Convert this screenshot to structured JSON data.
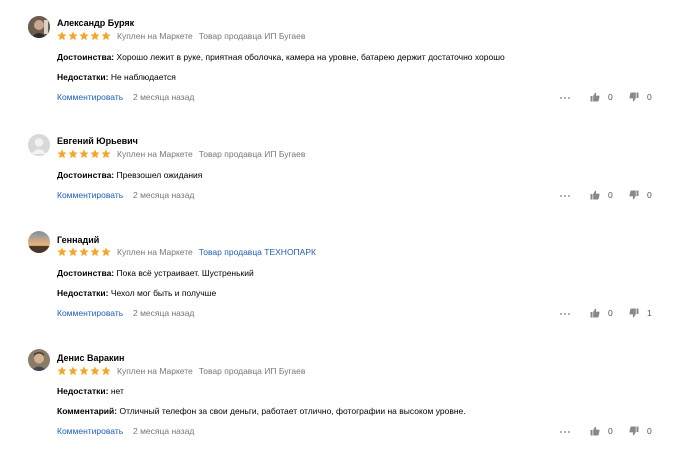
{
  "reviews": [
    {
      "author": "Александр Буряк",
      "rating": 5,
      "bought_label": "Куплен на Маркете",
      "seller_label": "Товар продавца ИП Бугаев",
      "seller_is_link": false,
      "fields": [
        {
          "label": "Достоинства:",
          "text": "Хорошо лежит в руке, приятная оболочка, камера на уровне, батарею держит достаточно хорошо"
        },
        {
          "label": "Недостатки:",
          "text": "Не наблюдается"
        }
      ],
      "comment_label": "Комментировать",
      "date": "2 месяца назад",
      "likes": "0",
      "dislikes": "0"
    },
    {
      "author": "Евгений Юрьевич",
      "rating": 5,
      "bought_label": "Куплен на Маркете",
      "seller_label": "Товар продавца ИП Бугаев",
      "seller_is_link": false,
      "fields": [
        {
          "label": "Достоинства:",
          "text": "Превзошел ожидания"
        }
      ],
      "comment_label": "Комментировать",
      "date": "2 месяца назад",
      "likes": "0",
      "dislikes": "0"
    },
    {
      "author": "Геннадий",
      "rating": 5,
      "bought_label": "Куплен на Маркете",
      "seller_label": "Товар продавца ТЕХНОПАРК",
      "seller_is_link": true,
      "fields": [
        {
          "label": "Достоинства:",
          "text": "Пока всё устраивает. Шустренький"
        },
        {
          "label": "Недостатки:",
          "text": "Чехол мог быть и получше"
        }
      ],
      "comment_label": "Комментировать",
      "date": "2 месяца назад",
      "likes": "0",
      "dislikes": "1"
    },
    {
      "author": "Денис Варакин",
      "rating": 5,
      "bought_label": "Куплен на Маркете",
      "seller_label": "Товар продавца ИП Бугаев",
      "seller_is_link": false,
      "fields": [
        {
          "label": "Недостатки:",
          "text": "нет"
        },
        {
          "label": "Комментарий:",
          "text": "Отличный телефон за свои деньги, работает отлично, фотографии на высоком уровне."
        }
      ],
      "comment_label": "Комментировать",
      "date": "2 месяца назад",
      "likes": "0",
      "dislikes": "0"
    }
  ],
  "colors": {
    "star": "#f5a623",
    "link": "#1a5fc4",
    "muted": "#777777",
    "icon": "#888888"
  }
}
